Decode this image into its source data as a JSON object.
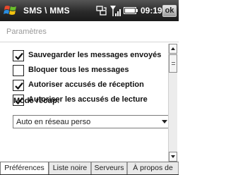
{
  "titlebar": {
    "app_title": "SMS \\ MMS",
    "time": "09:19",
    "ok_label": "ok",
    "icons": [
      "windows-start-icon",
      "sync-icon",
      "signal-icon",
      "battery-icon"
    ]
  },
  "header": {
    "title": "Paramètres"
  },
  "options": [
    {
      "label": "Sauvegarder les messages envoyés",
      "checked": true
    },
    {
      "label": "Bloquer tous les messages",
      "checked": false
    },
    {
      "label": "Autoriser accusés de réception",
      "checked": true
    },
    {
      "label": "Autoriser les accusés de lecture",
      "checked": true
    }
  ],
  "mode": {
    "label": "Mode récup:",
    "value": "Auto en réseau perso"
  },
  "tabs": [
    {
      "label": "Préférences",
      "active": true
    },
    {
      "label": "Liste noire",
      "active": false
    },
    {
      "label": "Serveurs",
      "active": false
    },
    {
      "label": "À propos de",
      "active": false
    }
  ],
  "colors": {
    "titlebar": "#2a2a2a",
    "checkmark": "#111111",
    "header_text": "#9a9a9a"
  }
}
